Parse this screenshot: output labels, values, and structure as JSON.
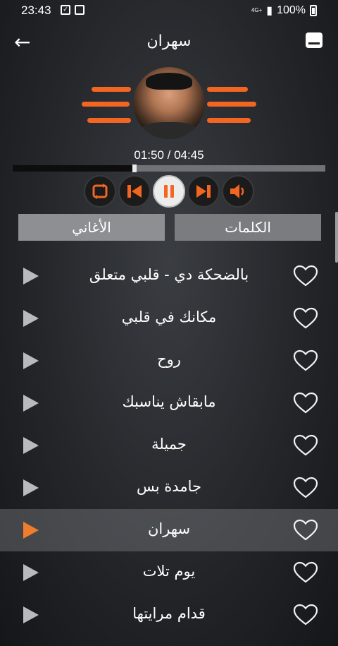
{
  "status": {
    "time": "23:43",
    "network": "4G+",
    "battery": "100%"
  },
  "header": {
    "title": "سهران"
  },
  "player": {
    "elapsed": "01:50",
    "duration": "04:45",
    "time_text": "01:50 / 04:45",
    "progress": 0.39
  },
  "tabs": [
    {
      "label": "الكلمات"
    },
    {
      "label": "الأغاني"
    }
  ],
  "songs": [
    {
      "title": "بالضحكة دي - قلبي متعلق"
    },
    {
      "title": "مكانك في قلبي"
    },
    {
      "title": "روح"
    },
    {
      "title": "مابقاش يناسبك"
    },
    {
      "title": "جميلة"
    },
    {
      "title": "جامدة بس"
    },
    {
      "title": "سهران",
      "active": true
    },
    {
      "title": "يوم تلات"
    },
    {
      "title": "قدام مرايتها"
    }
  ],
  "colors": {
    "accent": "#f26622",
    "active_play": "#f07c2e",
    "tab_bg": "#8d8f93"
  },
  "icons": [
    "back-arrow-icon",
    "menu-icon",
    "repeat-icon",
    "previous-icon",
    "pause-icon",
    "next-icon",
    "volume-icon",
    "play-icon",
    "heart-icon"
  ]
}
